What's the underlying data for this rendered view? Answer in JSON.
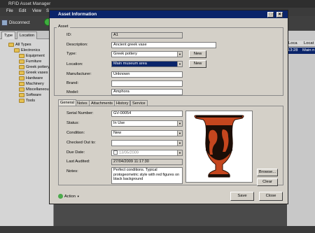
{
  "app": {
    "title": "RFID Asset Manager",
    "menu": [
      "File",
      "Edit",
      "View",
      "S"
    ],
    "toolbar": {
      "disconnect": "Disconnect"
    },
    "sidebar": {
      "tabs": [
        "Type",
        "Location"
      ],
      "tree": [
        "All Types",
        "Electronics",
        "Equipment",
        "Furniture",
        "Greek pottery",
        "Greek vases",
        "Hardware",
        "Machinery",
        "Miscellaneous",
        "Software",
        "Tools"
      ]
    },
    "right_panel": {
      "col1": "Loca",
      "col2": "Locat",
      "row_time": "13:28",
      "row_loc": "Main n"
    }
  },
  "dialog": {
    "title": "Asset Information",
    "group_label": "Asset",
    "labels": {
      "id": "ID:",
      "description": "Description:",
      "type": "Type:",
      "location": "Location:",
      "manufacturer": "Manufacturer:",
      "brand": "Brand:",
      "model": "Model:"
    },
    "values": {
      "id": "A1",
      "description": "Ancient greek vase",
      "type": "Greek pottery",
      "location": "Main museum area",
      "manufacturer": "Unknown",
      "brand": "",
      "model": "Amphora"
    },
    "new_type_button": "New",
    "new_location_button": "New",
    "tabs": [
      "General",
      "Notes",
      "Attachments",
      "History",
      "Service"
    ],
    "general": {
      "labels": {
        "serial": "Serial Number:",
        "status": "Status:",
        "condition": "Condition:",
        "checked_out": "Checked Out to:",
        "due_date": "Due Date:",
        "last_audited": "Last Audited:",
        "notes": "Notes:"
      },
      "values": {
        "serial": "GV-00054",
        "status": "In Use",
        "condition": "New",
        "checked_out": "",
        "due_date": "13/05/2009",
        "last_audited": "27/04/2009 11:17:30",
        "notes": "Perfect conditions. Typical protogeometric style with red figures on black background"
      },
      "browse_button": "Browse...",
      "clear_button": "Clear"
    },
    "action_label": "Action",
    "save_button": "Save",
    "close_button": "Close"
  }
}
